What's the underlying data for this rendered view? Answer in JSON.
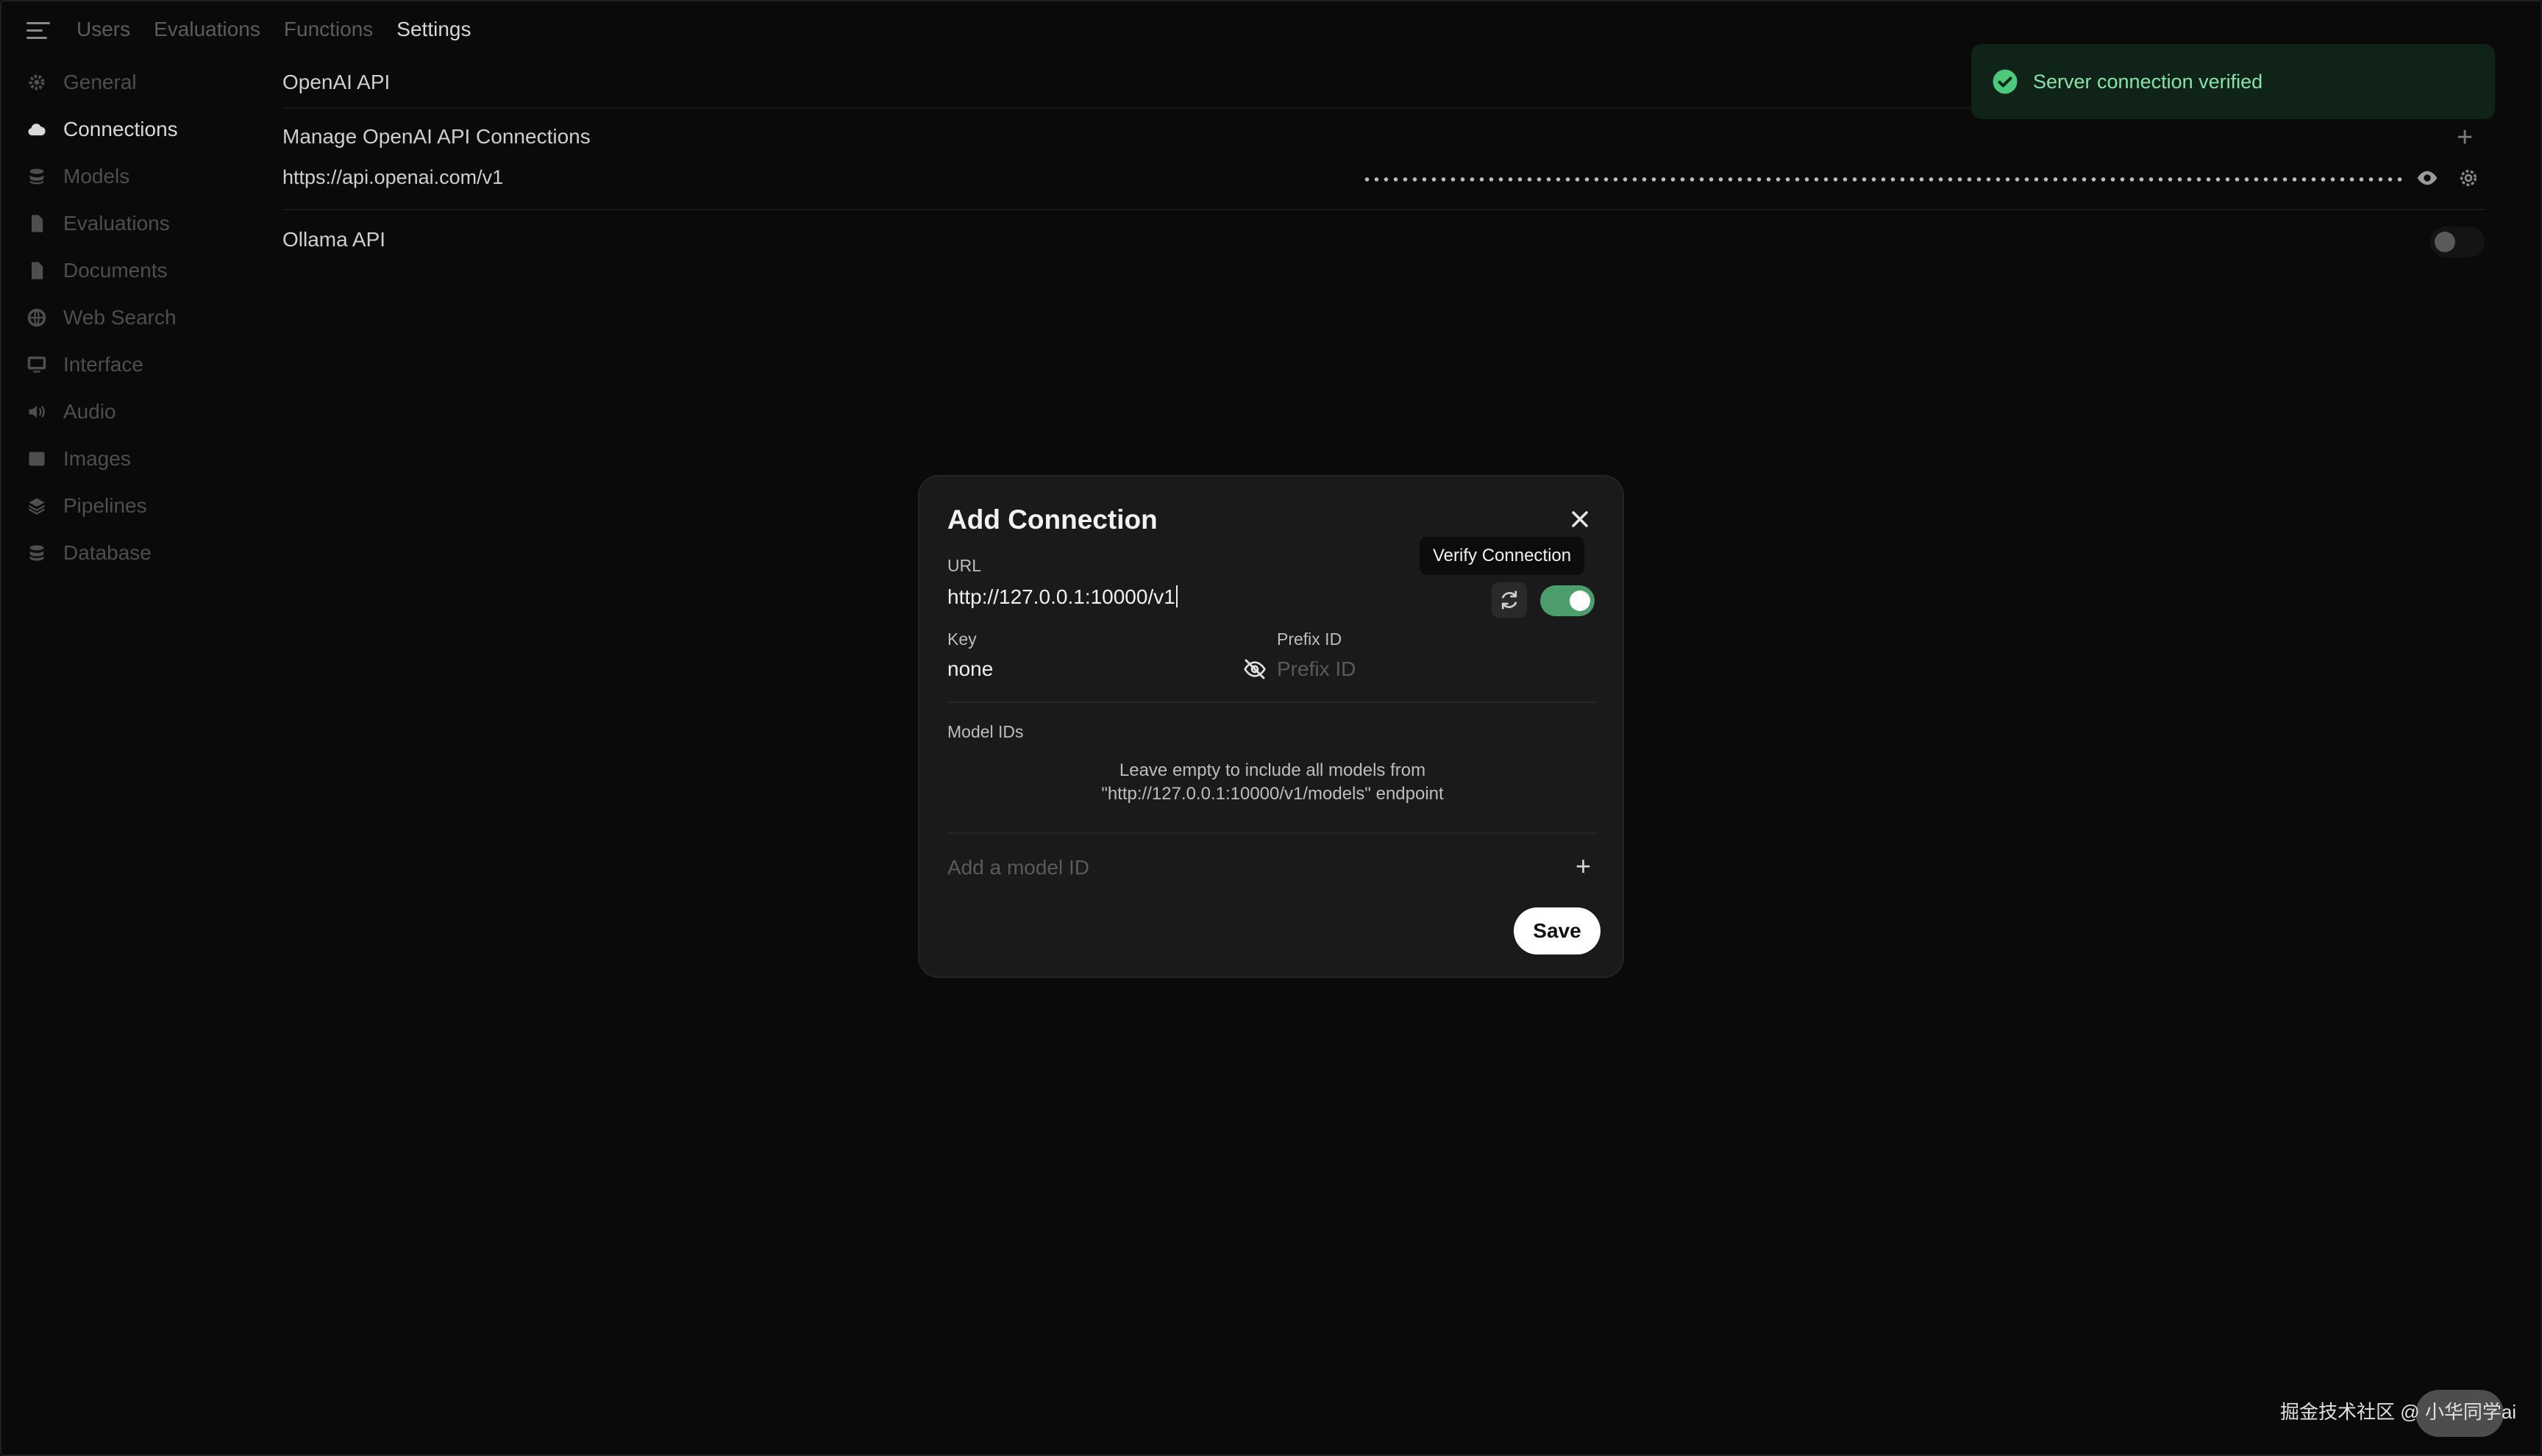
{
  "top_nav": {
    "items": [
      {
        "label": "Users",
        "active": false
      },
      {
        "label": "Evaluations",
        "active": false
      },
      {
        "label": "Functions",
        "active": false
      },
      {
        "label": "Settings",
        "active": true
      }
    ]
  },
  "sidebar": {
    "items": [
      {
        "label": "General",
        "icon": "gear-icon",
        "active": false
      },
      {
        "label": "Connections",
        "icon": "cloud-icon",
        "active": true
      },
      {
        "label": "Models",
        "icon": "cube-stack-icon",
        "active": false
      },
      {
        "label": "Evaluations",
        "icon": "document-icon",
        "active": false
      },
      {
        "label": "Documents",
        "icon": "document-icon",
        "active": false
      },
      {
        "label": "Web Search",
        "icon": "globe-icon",
        "active": false
      },
      {
        "label": "Interface",
        "icon": "monitor-icon",
        "active": false
      },
      {
        "label": "Audio",
        "icon": "speaker-icon",
        "active": false
      },
      {
        "label": "Images",
        "icon": "image-icon",
        "active": false
      },
      {
        "label": "Pipelines",
        "icon": "layers-icon",
        "active": false
      },
      {
        "label": "Database",
        "icon": "database-icon",
        "active": false
      }
    ]
  },
  "main": {
    "openai_title": "OpenAI API",
    "manage_title": "Manage OpenAI API Connections",
    "connection_url": "https://api.openai.com/v1",
    "ollama_title": "Ollama API",
    "ollama_enabled": false
  },
  "toast": {
    "message": "Server connection verified",
    "color": "#86e3a9"
  },
  "modal": {
    "title": "Add Connection",
    "url_label": "URL",
    "url_value": "http://127.0.0.1:10000/v1",
    "tooltip": "Verify Connection",
    "enabled": true,
    "key_label": "Key",
    "key_value": "none",
    "prefix_label": "Prefix ID",
    "prefix_placeholder": "Prefix ID",
    "model_ids_label": "Model IDs",
    "help_line1": "Leave empty to include all models from",
    "help_line2": "\"http://127.0.0.1:10000/v1/models\" endpoint",
    "add_model_placeholder": "Add a model ID",
    "save_label": "Save",
    "accent_color": "#4c9f6c"
  },
  "watermark": "掘金技术社区 @ 小华同学ai"
}
